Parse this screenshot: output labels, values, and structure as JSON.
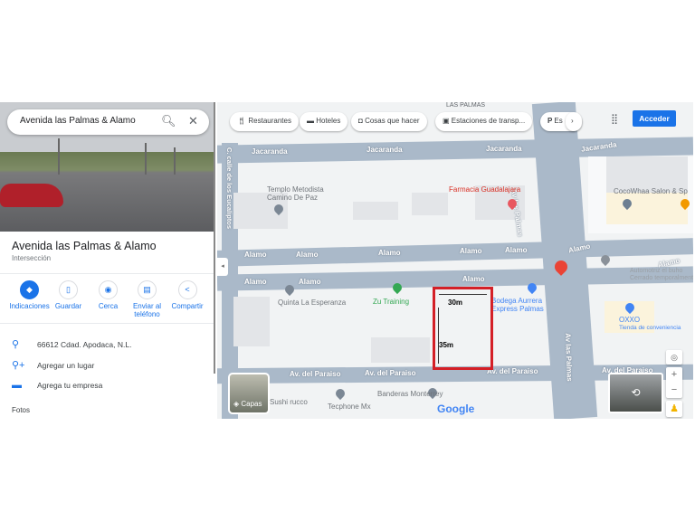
{
  "search": {
    "value": "Avenida las Palmas & Alamo"
  },
  "place": {
    "title": "Avenida las Palmas & Alamo",
    "type": "Intersección"
  },
  "actions": [
    {
      "label": "Indicaciones",
      "icon": "directions-icon"
    },
    {
      "label": "Guardar",
      "icon": "bookmark-icon"
    },
    {
      "label": "Cerca",
      "icon": "nearby-icon"
    },
    {
      "label": "Enviar al teléfono",
      "icon": "send-to-phone-icon"
    },
    {
      "label": "Compartir",
      "icon": "share-icon"
    }
  ],
  "info": {
    "address": "66612 Cdad. Apodaca, N.L.",
    "add_place": "Agregar un lugar",
    "add_business": "Agrega tu empresa",
    "photos": "Fotos"
  },
  "chips": [
    "Restaurantes",
    "Hoteles",
    "Cosas que hacer",
    "Estaciones de transp...",
    "Es"
  ],
  "signin": "Acceder",
  "streets": {
    "jacaranda": "Jacaranda",
    "alamo": "Alamo",
    "paraiso": "Av. del Paraiso",
    "palmas": "Av las Palmas",
    "eucaliptos": "C. calle de los Eucaliptos",
    "las_palmas_area": "LAS PALMAS"
  },
  "pois": {
    "templo": "Templo Metodista",
    "templo2": "Camino De Paz",
    "farmacia": "Farmacia Guadalajara",
    "cocowhaa": "CocoWhaa Salon & Sp",
    "automotive": "Automotriz el buho",
    "automotive_sub": "Cerrado temporalmente",
    "quinta": "Quinta La Esperanza",
    "zu": "Zu Training",
    "bodega": "Bodega Aurrera",
    "bodega2": "Express Palmas",
    "oxxo": "OXXO",
    "oxxo_sub": "Tienda de conveniencia",
    "banderas": "Banderas Monterrey",
    "tecphone": "Tecphone Mx",
    "sushi": "Sushi rucco"
  },
  "annotation": {
    "width": "30m",
    "height": "35m"
  },
  "layers": "Capas",
  "google": "Google",
  "colors": {
    "accent": "#1a73e8",
    "annotation": "#d42027"
  }
}
